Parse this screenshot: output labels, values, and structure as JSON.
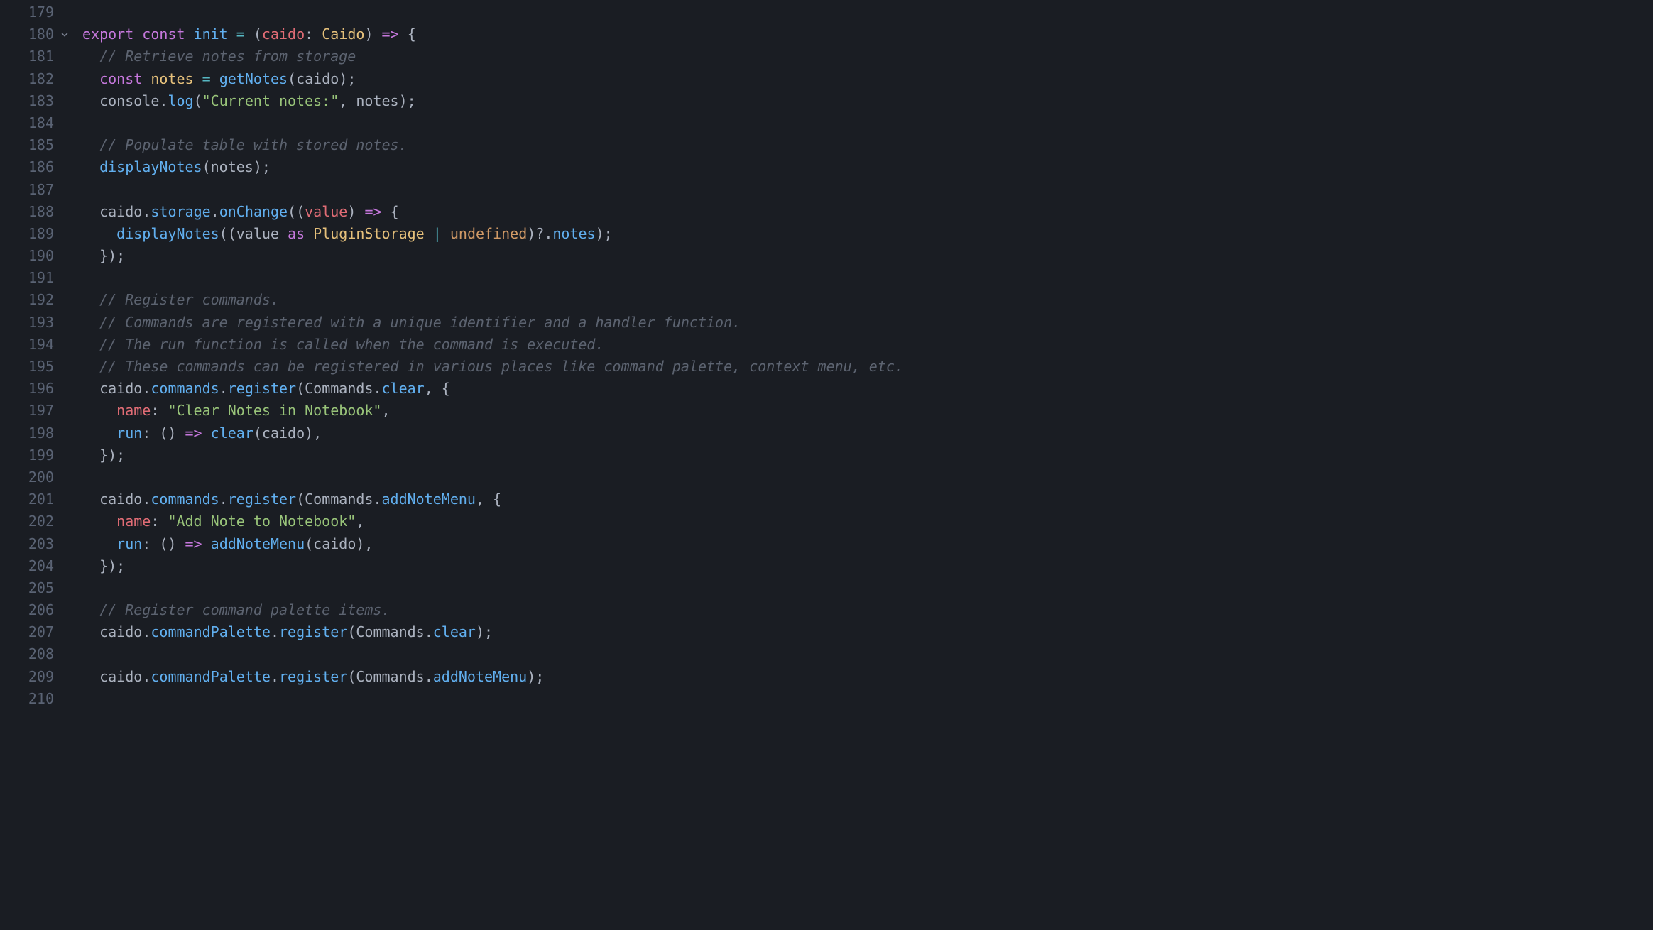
{
  "startLine": 179,
  "foldableLine": 180,
  "lines": [
    {
      "num": 179,
      "tokens": []
    },
    {
      "num": 180,
      "tokens": [
        {
          "t": "export",
          "c": "tk-keyword"
        },
        {
          "t": " ",
          "c": "tk-default"
        },
        {
          "t": "const",
          "c": "tk-const"
        },
        {
          "t": " ",
          "c": "tk-default"
        },
        {
          "t": "init",
          "c": "tk-func"
        },
        {
          "t": " ",
          "c": "tk-default"
        },
        {
          "t": "=",
          "c": "tk-op"
        },
        {
          "t": " ",
          "c": "tk-default"
        },
        {
          "t": "(",
          "c": "tk-punct"
        },
        {
          "t": "caido",
          "c": "tk-param"
        },
        {
          "t": ":",
          "c": "tk-punct"
        },
        {
          "t": " ",
          "c": "tk-default"
        },
        {
          "t": "Caido",
          "c": "tk-type"
        },
        {
          "t": ")",
          "c": "tk-punct"
        },
        {
          "t": " ",
          "c": "tk-default"
        },
        {
          "t": "=>",
          "c": "tk-op2"
        },
        {
          "t": " ",
          "c": "tk-default"
        },
        {
          "t": "{",
          "c": "tk-punct"
        }
      ]
    },
    {
      "num": 181,
      "tokens": [
        {
          "t": "  ",
          "c": "tk-default"
        },
        {
          "t": "// Retrieve notes from storage",
          "c": "tk-comment"
        }
      ]
    },
    {
      "num": 182,
      "tokens": [
        {
          "t": "  ",
          "c": "tk-default"
        },
        {
          "t": "const",
          "c": "tk-const"
        },
        {
          "t": " ",
          "c": "tk-default"
        },
        {
          "t": "notes",
          "c": "tk-var2"
        },
        {
          "t": " ",
          "c": "tk-default"
        },
        {
          "t": "=",
          "c": "tk-op"
        },
        {
          "t": " ",
          "c": "tk-default"
        },
        {
          "t": "getNotes",
          "c": "tk-func"
        },
        {
          "t": "(",
          "c": "tk-punct"
        },
        {
          "t": "caido",
          "c": "tk-default"
        },
        {
          "t": ");",
          "c": "tk-punct"
        }
      ]
    },
    {
      "num": 183,
      "tokens": [
        {
          "t": "  ",
          "c": "tk-default"
        },
        {
          "t": "console",
          "c": "tk-default"
        },
        {
          "t": ".",
          "c": "tk-punct"
        },
        {
          "t": "log",
          "c": "tk-func"
        },
        {
          "t": "(",
          "c": "tk-punct"
        },
        {
          "t": "\"Current notes:\"",
          "c": "tk-string"
        },
        {
          "t": ", ",
          "c": "tk-punct"
        },
        {
          "t": "notes",
          "c": "tk-default"
        },
        {
          "t": ");",
          "c": "tk-punct"
        }
      ]
    },
    {
      "num": 184,
      "tokens": []
    },
    {
      "num": 185,
      "tokens": [
        {
          "t": "  ",
          "c": "tk-default"
        },
        {
          "t": "// Populate table with stored notes.",
          "c": "tk-comment"
        }
      ]
    },
    {
      "num": 186,
      "tokens": [
        {
          "t": "  ",
          "c": "tk-default"
        },
        {
          "t": "displayNotes",
          "c": "tk-func"
        },
        {
          "t": "(",
          "c": "tk-punct"
        },
        {
          "t": "notes",
          "c": "tk-default"
        },
        {
          "t": ");",
          "c": "tk-punct"
        }
      ]
    },
    {
      "num": 187,
      "tokens": []
    },
    {
      "num": 188,
      "tokens": [
        {
          "t": "  ",
          "c": "tk-default"
        },
        {
          "t": "caido",
          "c": "tk-default"
        },
        {
          "t": ".",
          "c": "tk-punct"
        },
        {
          "t": "storage",
          "c": "tk-prop2"
        },
        {
          "t": ".",
          "c": "tk-punct"
        },
        {
          "t": "onChange",
          "c": "tk-func"
        },
        {
          "t": "((",
          "c": "tk-punct"
        },
        {
          "t": "value",
          "c": "tk-param"
        },
        {
          "t": ") ",
          "c": "tk-punct"
        },
        {
          "t": "=>",
          "c": "tk-op2"
        },
        {
          "t": " {",
          "c": "tk-punct"
        }
      ]
    },
    {
      "num": 189,
      "tokens": [
        {
          "t": "    ",
          "c": "tk-default"
        },
        {
          "t": "displayNotes",
          "c": "tk-func"
        },
        {
          "t": "((",
          "c": "tk-punct"
        },
        {
          "t": "value",
          "c": "tk-default"
        },
        {
          "t": " ",
          "c": "tk-default"
        },
        {
          "t": "as",
          "c": "tk-keyword"
        },
        {
          "t": " ",
          "c": "tk-default"
        },
        {
          "t": "PluginStorage",
          "c": "tk-type"
        },
        {
          "t": " ",
          "c": "tk-default"
        },
        {
          "t": "|",
          "c": "tk-op"
        },
        {
          "t": " ",
          "c": "tk-default"
        },
        {
          "t": "undefined",
          "c": "tk-param2"
        },
        {
          "t": ")?.",
          "c": "tk-punct"
        },
        {
          "t": "notes",
          "c": "tk-prop2"
        },
        {
          "t": ");",
          "c": "tk-punct"
        }
      ]
    },
    {
      "num": 190,
      "tokens": [
        {
          "t": "  ",
          "c": "tk-default"
        },
        {
          "t": "});",
          "c": "tk-punct"
        }
      ]
    },
    {
      "num": 191,
      "tokens": []
    },
    {
      "num": 192,
      "tokens": [
        {
          "t": "  ",
          "c": "tk-default"
        },
        {
          "t": "// Register commands.",
          "c": "tk-comment"
        }
      ]
    },
    {
      "num": 193,
      "tokens": [
        {
          "t": "  ",
          "c": "tk-default"
        },
        {
          "t": "// Commands are registered with a unique identifier and a handler function.",
          "c": "tk-comment"
        }
      ]
    },
    {
      "num": 194,
      "tokens": [
        {
          "t": "  ",
          "c": "tk-default"
        },
        {
          "t": "// The run function is called when the command is executed.",
          "c": "tk-comment"
        }
      ]
    },
    {
      "num": 195,
      "tokens": [
        {
          "t": "  ",
          "c": "tk-default"
        },
        {
          "t": "// These commands can be registered in various places like command palette, context menu, etc.",
          "c": "tk-comment"
        }
      ]
    },
    {
      "num": 196,
      "tokens": [
        {
          "t": "  ",
          "c": "tk-default"
        },
        {
          "t": "caido",
          "c": "tk-default"
        },
        {
          "t": ".",
          "c": "tk-punct"
        },
        {
          "t": "commands",
          "c": "tk-prop2"
        },
        {
          "t": ".",
          "c": "tk-punct"
        },
        {
          "t": "register",
          "c": "tk-func"
        },
        {
          "t": "(",
          "c": "tk-punct"
        },
        {
          "t": "Commands",
          "c": "tk-default"
        },
        {
          "t": ".",
          "c": "tk-punct"
        },
        {
          "t": "clear",
          "c": "tk-prop2"
        },
        {
          "t": ", {",
          "c": "tk-punct"
        }
      ]
    },
    {
      "num": 197,
      "tokens": [
        {
          "t": "    ",
          "c": "tk-default"
        },
        {
          "t": "name",
          "c": "tk-prop"
        },
        {
          "t": ":",
          "c": "tk-punct"
        },
        {
          "t": " ",
          "c": "tk-default"
        },
        {
          "t": "\"Clear Notes in Notebook\"",
          "c": "tk-string"
        },
        {
          "t": ",",
          "c": "tk-punct"
        }
      ]
    },
    {
      "num": 198,
      "tokens": [
        {
          "t": "    ",
          "c": "tk-default"
        },
        {
          "t": "run",
          "c": "tk-func"
        },
        {
          "t": ":",
          "c": "tk-punct"
        },
        {
          "t": " () ",
          "c": "tk-punct"
        },
        {
          "t": "=>",
          "c": "tk-op2"
        },
        {
          "t": " ",
          "c": "tk-default"
        },
        {
          "t": "clear",
          "c": "tk-func"
        },
        {
          "t": "(",
          "c": "tk-punct"
        },
        {
          "t": "caido",
          "c": "tk-default"
        },
        {
          "t": "),",
          "c": "tk-punct"
        }
      ]
    },
    {
      "num": 199,
      "tokens": [
        {
          "t": "  ",
          "c": "tk-default"
        },
        {
          "t": "});",
          "c": "tk-punct"
        }
      ]
    },
    {
      "num": 200,
      "tokens": []
    },
    {
      "num": 201,
      "tokens": [
        {
          "t": "  ",
          "c": "tk-default"
        },
        {
          "t": "caido",
          "c": "tk-default"
        },
        {
          "t": ".",
          "c": "tk-punct"
        },
        {
          "t": "commands",
          "c": "tk-prop2"
        },
        {
          "t": ".",
          "c": "tk-punct"
        },
        {
          "t": "register",
          "c": "tk-func"
        },
        {
          "t": "(",
          "c": "tk-punct"
        },
        {
          "t": "Commands",
          "c": "tk-default"
        },
        {
          "t": ".",
          "c": "tk-punct"
        },
        {
          "t": "addNoteMenu",
          "c": "tk-prop2"
        },
        {
          "t": ", {",
          "c": "tk-punct"
        }
      ]
    },
    {
      "num": 202,
      "tokens": [
        {
          "t": "    ",
          "c": "tk-default"
        },
        {
          "t": "name",
          "c": "tk-prop"
        },
        {
          "t": ":",
          "c": "tk-punct"
        },
        {
          "t": " ",
          "c": "tk-default"
        },
        {
          "t": "\"Add Note to Notebook\"",
          "c": "tk-string"
        },
        {
          "t": ",",
          "c": "tk-punct"
        }
      ]
    },
    {
      "num": 203,
      "tokens": [
        {
          "t": "    ",
          "c": "tk-default"
        },
        {
          "t": "run",
          "c": "tk-func"
        },
        {
          "t": ":",
          "c": "tk-punct"
        },
        {
          "t": " () ",
          "c": "tk-punct"
        },
        {
          "t": "=>",
          "c": "tk-op2"
        },
        {
          "t": " ",
          "c": "tk-default"
        },
        {
          "t": "addNoteMenu",
          "c": "tk-func"
        },
        {
          "t": "(",
          "c": "tk-punct"
        },
        {
          "t": "caido",
          "c": "tk-default"
        },
        {
          "t": "),",
          "c": "tk-punct"
        }
      ]
    },
    {
      "num": 204,
      "tokens": [
        {
          "t": "  ",
          "c": "tk-default"
        },
        {
          "t": "});",
          "c": "tk-punct"
        }
      ]
    },
    {
      "num": 205,
      "tokens": []
    },
    {
      "num": 206,
      "tokens": [
        {
          "t": "  ",
          "c": "tk-default"
        },
        {
          "t": "// Register command palette items.",
          "c": "tk-comment"
        }
      ]
    },
    {
      "num": 207,
      "tokens": [
        {
          "t": "  ",
          "c": "tk-default"
        },
        {
          "t": "caido",
          "c": "tk-default"
        },
        {
          "t": ".",
          "c": "tk-punct"
        },
        {
          "t": "commandPalette",
          "c": "tk-prop2"
        },
        {
          "t": ".",
          "c": "tk-punct"
        },
        {
          "t": "register",
          "c": "tk-func"
        },
        {
          "t": "(",
          "c": "tk-punct"
        },
        {
          "t": "Commands",
          "c": "tk-default"
        },
        {
          "t": ".",
          "c": "tk-punct"
        },
        {
          "t": "clear",
          "c": "tk-prop2"
        },
        {
          "t": ");",
          "c": "tk-punct"
        }
      ]
    },
    {
      "num": 208,
      "tokens": []
    },
    {
      "num": 209,
      "tokens": [
        {
          "t": "  ",
          "c": "tk-default"
        },
        {
          "t": "caido",
          "c": "tk-default"
        },
        {
          "t": ".",
          "c": "tk-punct"
        },
        {
          "t": "commandPalette",
          "c": "tk-prop2"
        },
        {
          "t": ".",
          "c": "tk-punct"
        },
        {
          "t": "register",
          "c": "tk-func"
        },
        {
          "t": "(",
          "c": "tk-punct"
        },
        {
          "t": "Commands",
          "c": "tk-default"
        },
        {
          "t": ".",
          "c": "tk-punct"
        },
        {
          "t": "addNoteMenu",
          "c": "tk-prop2"
        },
        {
          "t": ");",
          "c": "tk-punct"
        }
      ]
    },
    {
      "num": 210,
      "tokens": []
    }
  ]
}
